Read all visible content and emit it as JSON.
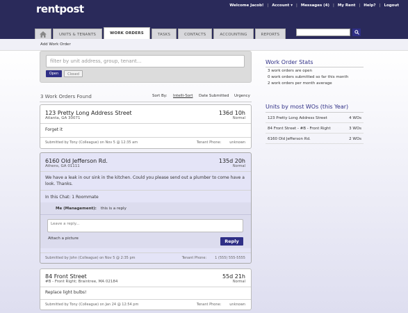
{
  "header": {
    "logo": "rentpost",
    "welcome": "Welcome Jacob!",
    "account": "Account",
    "messages": "Messages (4)",
    "my_rent": "My Rent",
    "help": "Help?",
    "logout": "Logout"
  },
  "tabs": [
    {
      "label": "UNITS & TENANTS"
    },
    {
      "label": "WORK ORDERS"
    },
    {
      "label": "TASKS"
    },
    {
      "label": "CONTACTS"
    },
    {
      "label": "ACCOUNTING"
    },
    {
      "label": "REPORTS"
    }
  ],
  "subbar": {
    "add_work_order": "Add Work Order"
  },
  "filter": {
    "placeholder": "filter by unit address, group, tenant...",
    "open_label": "Open",
    "closed_label": "Closed"
  },
  "list": {
    "found": "3 Work Orders Found",
    "sort_by": "Sort By:",
    "sort_options": [
      "Intelli-Sort",
      "Date Submitted",
      "Urgency"
    ]
  },
  "work_orders": [
    {
      "address": "123 Pretty Long Address Street",
      "city": "Atlanta, GA 30071",
      "age": "136d 10h",
      "priority": "Normal",
      "description": "Forget it",
      "submitted_prefix": "Submitted by",
      "submitted_by": "Tony (Colleague)",
      "submitted_on": "on Nov 5 @ 12:35 am",
      "phone_label": "Tenant Phone:",
      "phone": "unknown"
    },
    {
      "address": "6160 Old Jefferson Rd.",
      "city": "Athens, GA 01111",
      "age": "135d 20h",
      "priority": "Normal",
      "description": "We have a leak in our sink in the kitchen. Could you please send out a plumber to come have a look. Thanks.",
      "chat_info": "In this Chat: 1 Roommate",
      "chat_author": "Me (Management):",
      "chat_message": "this is a reply",
      "reply_placeholder": "Leave a reply...",
      "attach_label": "Attach a picture",
      "reply_button": "Reply",
      "submitted_prefix": "Submitted by",
      "submitted_by": "John (Colleague)",
      "submitted_on": "on Nov 5 @ 2:35 pm",
      "phone_label": "Tenant Phone:",
      "phone": "1 (555) 555-5555"
    },
    {
      "address": "84 Front Street",
      "city": "#B - Front Right; Braintree, MA 02184",
      "age": "55d 21h",
      "priority": "Normal",
      "description": "Replace light bulbs!",
      "submitted_prefix": "Submitted by",
      "submitted_by": "Tony (Colleague)",
      "submitted_on": "on Jan 24 @ 12:54 pm",
      "phone_label": "Tenant Phone:",
      "phone": "unknown"
    }
  ],
  "stats": {
    "title": "Work Order Stats",
    "lines": [
      "3 work orders are open",
      "0 work orders submitted so far this month",
      "2 work orders per month average"
    ]
  },
  "units": {
    "title": "Units by most WOs (this Year)",
    "rows": [
      {
        "name": "123 Pretty Long Address Street",
        "count": "4 WOs"
      },
      {
        "name": "84 Front Street - #B - Front Right",
        "count": "3 WOs"
      },
      {
        "name": "6160 Old Jefferson Rd.",
        "count": "2 WOs"
      }
    ]
  }
}
